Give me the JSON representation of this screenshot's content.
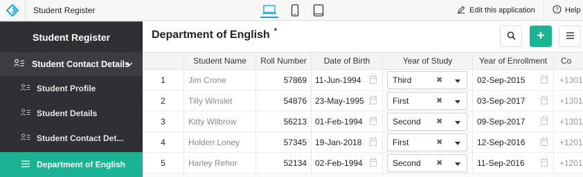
{
  "topbar": {
    "app_title": "Student Register",
    "edit_label": "Edit this application",
    "help_label": "Help"
  },
  "sidebar": {
    "title": "Student Register",
    "section_label": "Student Contact Details",
    "items": [
      {
        "label": "Student Profile"
      },
      {
        "label": "Student Details"
      },
      {
        "label": "Student Contact Det..."
      },
      {
        "label": "Department of English"
      }
    ]
  },
  "main": {
    "page_title": "Department of English",
    "title_marker": "*",
    "columns": [
      "Student Name",
      "Roll Number",
      "Date of Birth",
      "Year of Study",
      "Year of Enrollment",
      "Co"
    ],
    "rows": [
      {
        "index": "1",
        "name": "Jim Crone",
        "roll": "57869",
        "dob": "11-Jun-1994",
        "year": "Third",
        "enrollment": "02-Sep-2015",
        "contact": "+1301"
      },
      {
        "index": "2",
        "name": "Tilly Winslet",
        "roll": "54876",
        "dob": "23-May-1995",
        "year": "First",
        "enrollment": "03-Sep-2017",
        "contact": "+1301"
      },
      {
        "index": "3",
        "name": "Kitty Wilbrow",
        "roll": "56213",
        "dob": "01-Feb-1994",
        "year": "Second",
        "enrollment": "09-Sep-2017",
        "contact": "+1301"
      },
      {
        "index": "4",
        "name": "Holden Loney",
        "roll": "57345",
        "dob": "19-Jan-2018",
        "year": "First",
        "enrollment": "12-Sep-2016",
        "contact": "+1201"
      },
      {
        "index": "5",
        "name": "Harley Rehor",
        "roll": "52134",
        "dob": "02-Feb-1994",
        "year": "Second",
        "enrollment": "11-Sep-2016",
        "contact": "+1201"
      }
    ],
    "clear_glyph": "✖"
  },
  "icons": {
    "logo": "app-logo-icon",
    "desktop": "desktop-icon",
    "phone": "phone-icon",
    "tablet": "tablet-icon",
    "pencil": "pencil-icon",
    "help": "help-icon",
    "search": "search-icon",
    "add": "plus-icon",
    "menu": "hamburger-icon"
  },
  "colors": {
    "accent": "#1ab394",
    "sidebar_bg": "#2f3033",
    "sidebar_section_bg": "#3c3d40",
    "device_active": "#1aa3e8"
  }
}
